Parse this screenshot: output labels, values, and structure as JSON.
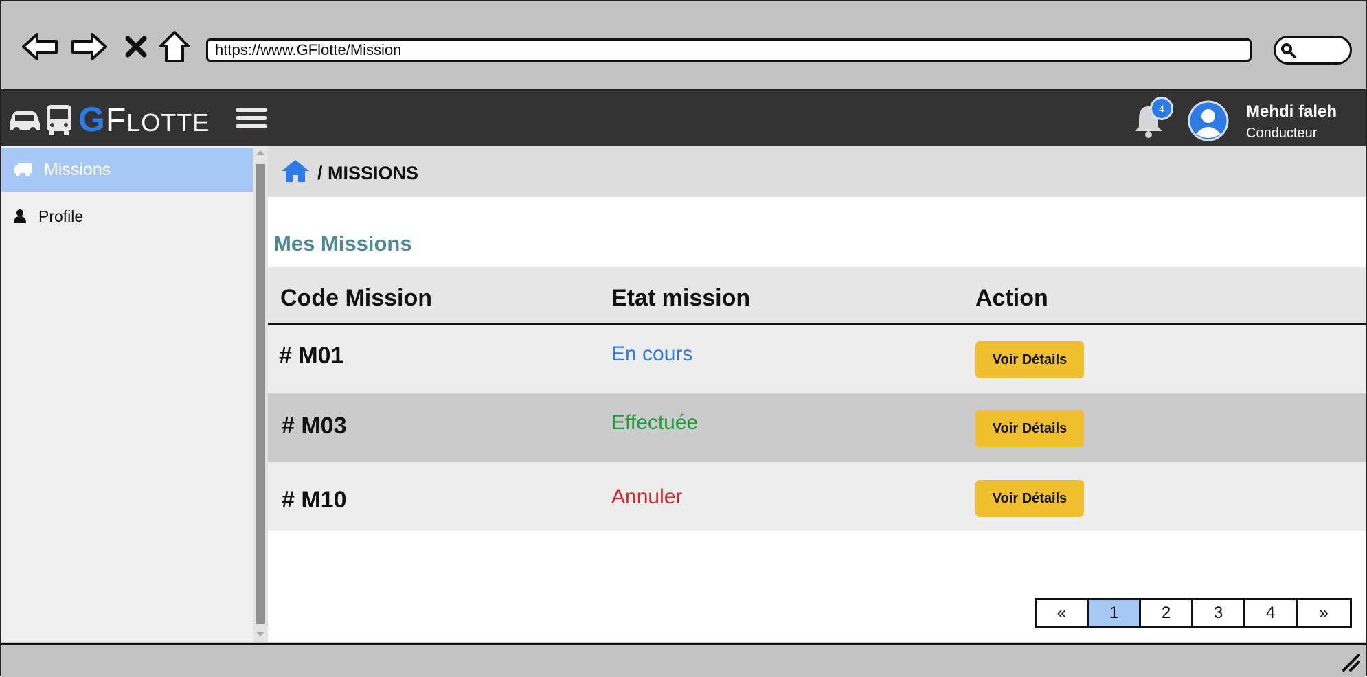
{
  "browser": {
    "url": "https://www.GFlotte/Mission"
  },
  "app": {
    "brand_g": "G",
    "brand_f": "F",
    "brand_rest": "LOTTE",
    "notification_count": "4",
    "user_name": "Mehdi faleh",
    "user_role": "Conducteur"
  },
  "sidebar": {
    "items": [
      {
        "label": "Missions",
        "icon": "truck-icon",
        "active": true
      },
      {
        "label": "Profile",
        "icon": "user-icon",
        "active": false
      }
    ]
  },
  "breadcrumb": {
    "text": "/ MISSIONS"
  },
  "main": {
    "title": "Mes Missions",
    "columns": [
      "Code Mission",
      "Etat mission",
      "Action"
    ],
    "rows": [
      {
        "code": "# M01",
        "state": "En cours",
        "state_color": "#2f7be6",
        "action": "Voir Détails"
      },
      {
        "code": "# M03",
        "state": "Effectuée",
        "state_color": "#1f9e3a",
        "action": "Voir Détails"
      },
      {
        "code": "# M10",
        "state": "Annuler",
        "state_color": "#d7262e",
        "action": "Voir Détails"
      }
    ]
  },
  "pagination": {
    "prev": "«",
    "pages": [
      "1",
      "2",
      "3",
      "4"
    ],
    "current": "1",
    "next": "»"
  },
  "colors": {
    "accent": "#2f7be6",
    "sidebar_active": "#a7c8f7",
    "button": "#f0bf2f",
    "title": "#4e8a96"
  }
}
